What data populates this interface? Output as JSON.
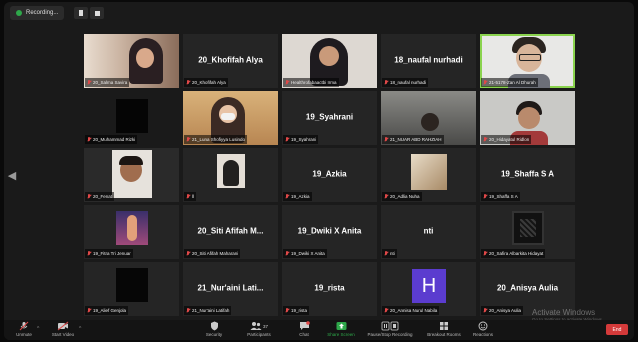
{
  "topbar": {
    "recording_label": "Recording..."
  },
  "tiles": [
    {
      "label": "20_Salma Savira",
      "video": true
    },
    {
      "name": "20_Khofifah Alya",
      "label": "20_Khofifah Alya"
    },
    {
      "label": "Healthrofabaactbi Irma",
      "video": true
    },
    {
      "name": "18_naufal nurhadi",
      "label": "18_naufal nurhadi"
    },
    {
      "label": "21-5178-Zan Al Dhurah",
      "video": true,
      "active": true
    },
    {
      "label": "20_Muhammad Rizki",
      "video": true
    },
    {
      "label": "21_Luna Shofiyya Lusindo",
      "video": true
    },
    {
      "name": "19_Syahrani",
      "label": "19_Syahrani"
    },
    {
      "label": "21_NUAR ABD RAHZIAH",
      "video": true
    },
    {
      "label": "20_Hidayatul Ridlon",
      "video": true
    },
    {
      "label": "20_Fenat",
      "video": true
    },
    {
      "label": "ll",
      "video": true
    },
    {
      "name": "19_Azkia",
      "label": "19_Azkia"
    },
    {
      "label": "20_Adlia Nuha",
      "video": true
    },
    {
      "name": "19_Shaffa S A",
      "label": "19_Shaffa S A"
    },
    {
      "label": "19_Fitra Tri Jenuar",
      "video": true
    },
    {
      "name": "20_Siti Afifah M...",
      "label": "20_Siti Afifah Maharani"
    },
    {
      "name": "19_Dwiki X Anita",
      "label": "19_Dwiki X Anita"
    },
    {
      "name": "nti",
      "label": "nti"
    },
    {
      "label": "20_Safira Albarkita Hidayat",
      "video": true
    },
    {
      "label": "19_Alief Genjola",
      "video": true
    },
    {
      "name": "21_Nur'aini Lati...",
      "label": "21_Nur'aini Latifah"
    },
    {
      "name": "19_rista",
      "label": "19_rista"
    },
    {
      "avatar_letter": "H",
      "label": "20_Annisa Nurul Nabila"
    },
    {
      "name": "20_Anisya Aulia",
      "label": "20_Anisya Aulia"
    }
  ],
  "toolbar": {
    "unmute": "Unmute",
    "start_video": "Start Video",
    "security": "Security",
    "participants": "Participants",
    "participants_count": "37",
    "chat": "Chat",
    "share_screen": "Share Screen",
    "pause_recording": "Pause/Stop Recording",
    "breakout_rooms": "Breakout Rooms",
    "reactions": "Reactions",
    "end": "End"
  },
  "watermark": {
    "title": "Activate Windows",
    "subtitle": "Go to Settings to activate Windows."
  },
  "colors": {
    "accent_green": "#2ea84a",
    "active_speaker": "#8ad34e",
    "muted_red": "#e04848",
    "avatar_purple": "#5b3ccf"
  }
}
